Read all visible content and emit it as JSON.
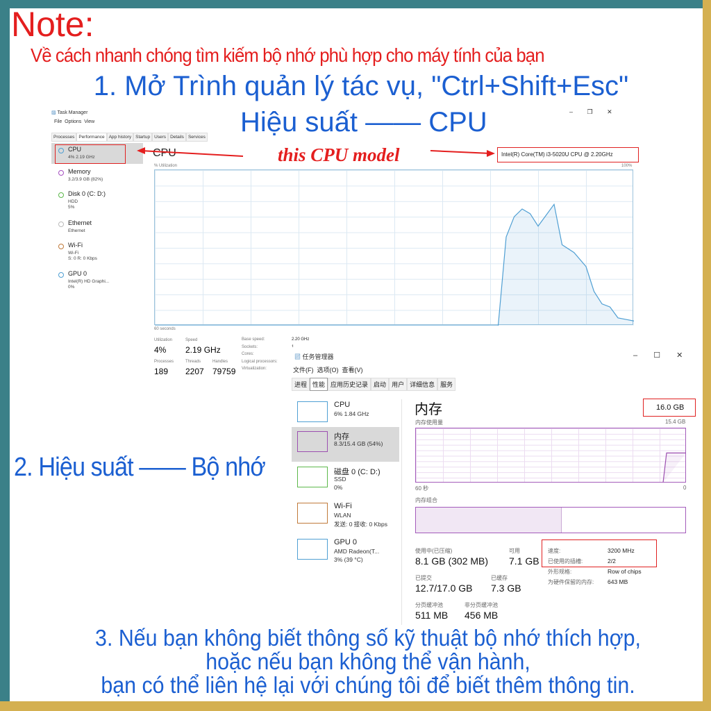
{
  "colors": {
    "red": "#e41e1e",
    "blue": "#1b5fd1",
    "frame_left": "#3b8088",
    "frame_right": "#d4b051",
    "cpu_line": "#4f9fd3",
    "mem_line": "#9c4fb0"
  },
  "note": {
    "title": "Note:",
    "subtitle": "Về cách nhanh chóng tìm kiếm bộ nhớ phù hợp cho máy tính của bạn"
  },
  "step1": {
    "line1": "1. Mở Trình quản lý tác vụ, \"Ctrl+Shift+Esc\"",
    "line2": "Hiệu suất —— CPU"
  },
  "step2": {
    "label": "2. Hiệu suất —— Bộ nhớ"
  },
  "step3": {
    "line1": "3. Nếu bạn không biết thông số kỹ thuật bộ nhớ thích hợp,",
    "line2": "hoặc nếu bạn không thể vận hành,",
    "line3": "bạn có thể liên hệ lại với chúng tôi để biết thêm thông tin."
  },
  "annotation": {
    "cpu_model_label": "this CPU model"
  },
  "tm_en": {
    "title": "Task Manager",
    "menu": [
      "File",
      "Options",
      "View"
    ],
    "tabs": [
      "Processes",
      "Performance",
      "App history",
      "Startup",
      "Users",
      "Details",
      "Services"
    ],
    "active_tab": "Performance",
    "sidebar": [
      {
        "title": "CPU",
        "sub1": "4% 2.19 GHz",
        "sub2": "",
        "color": "#4f9fd3"
      },
      {
        "title": "Memory",
        "sub1": "3.2/3.9 GB (82%)",
        "sub2": "",
        "color": "#a54fc0"
      },
      {
        "title": "Disk 0 (C: D:)",
        "sub1": "HDD",
        "sub2": "5%",
        "color": "#5cb84a"
      },
      {
        "title": "Ethernet",
        "sub1": "Ethernet",
        "sub2": "",
        "color": "#bbbbbb"
      },
      {
        "title": "Wi-Fi",
        "sub1": "Wi-Fi",
        "sub2": "S: 0 R: 0 Kbps",
        "color": "#c07a3a"
      },
      {
        "title": "GPU 0",
        "sub1": "Intel(R) HD Graphi...",
        "sub2": "0%",
        "color": "#4f9fd3"
      }
    ],
    "main_title": "CPU",
    "cpu_model": "Intel(R) Core(TM) i3-5020U CPU @ 2.20GHz",
    "graph_label": "% Utilization",
    "graph_max": "100%",
    "graph_time": "60 seconds",
    "cpu_history": [
      [
        0,
        0
      ],
      [
        43,
        0
      ],
      [
        44,
        57
      ],
      [
        45,
        70
      ],
      [
        46,
        75
      ],
      [
        47,
        72
      ],
      [
        48,
        64
      ],
      [
        50,
        78
      ],
      [
        51,
        52
      ],
      [
        52.5,
        47
      ],
      [
        54,
        38
      ],
      [
        55,
        22
      ],
      [
        56,
        14
      ],
      [
        57,
        12
      ],
      [
        58,
        5
      ],
      [
        59,
        4
      ],
      [
        60,
        3
      ]
    ],
    "stats": {
      "utilization_label": "Utilization",
      "utilization": "4%",
      "speed_label": "Speed",
      "speed": "2.19 GHz",
      "processes_label": "Processes",
      "processes": "189",
      "threads_label": "Threads",
      "threads": "2207",
      "handles_label": "Handles",
      "handles": "79759"
    },
    "specs": [
      {
        "k": "Base speed:",
        "v": "2.20 GHz"
      },
      {
        "k": "Sockets:",
        "v": "1"
      },
      {
        "k": "Cores:",
        "v": ""
      },
      {
        "k": "Logical processors:",
        "v": ""
      },
      {
        "k": "Virtualization:",
        "v": ""
      }
    ]
  },
  "tm_cn": {
    "title": "任务管理器",
    "menu": [
      "文件(F)",
      "选项(O)",
      "查看(V)"
    ],
    "tabs": [
      "进程",
      "性能",
      "应用历史记录",
      "启动",
      "用户",
      "详细信息",
      "服务"
    ],
    "sidebar": [
      {
        "title": "CPU",
        "sub1": "6% 1.84 GHz",
        "sub2": "",
        "color": "#4f9fd3"
      },
      {
        "title": "内存",
        "sub1": "8.3/15.4 GB (54%)",
        "sub2": "",
        "color": "#9c4fb0"
      },
      {
        "title": "磁盘 0 (C: D:)",
        "sub1": "SSD",
        "sub2": "0%",
        "color": "#5cb84a"
      },
      {
        "title": "Wi-Fi",
        "sub1": "WLAN",
        "sub2": "发送: 0 接收: 0 Kbps",
        "color": "#c07a3a"
      },
      {
        "title": "GPU 0",
        "sub1": "AMD Radeon(T...",
        "sub2": "3% (39 °C)",
        "color": "#4f9fd3"
      }
    ],
    "main_title": "内存",
    "total": "16.0 GB",
    "usage_label": "内存使用量",
    "usage_max": "15.4 GB",
    "time_left": "60 秒",
    "time_right": "0",
    "composition_label": "内存组合",
    "usage_percent": 54,
    "stats": [
      {
        "k": "使用中(已压缩)",
        "v": "8.1 GB (302 MB)"
      },
      {
        "k": "可用",
        "v": "7.1 GB"
      },
      {
        "k": "已提交",
        "v": "12.7/17.0 GB"
      },
      {
        "k": "已缓存",
        "v": "7.3 GB"
      },
      {
        "k": "分页缓冲池",
        "v": "511 MB"
      },
      {
        "k": "非分页缓冲池",
        "v": "456 MB"
      }
    ],
    "specs": [
      {
        "k": "速度:",
        "v": "3200 MHz"
      },
      {
        "k": "已使用的插槽:",
        "v": "2/2"
      },
      {
        "k": "外形规格:",
        "v": "Row of chips"
      },
      {
        "k": "为硬件保留的内存:",
        "v": "643 MB"
      }
    ]
  }
}
